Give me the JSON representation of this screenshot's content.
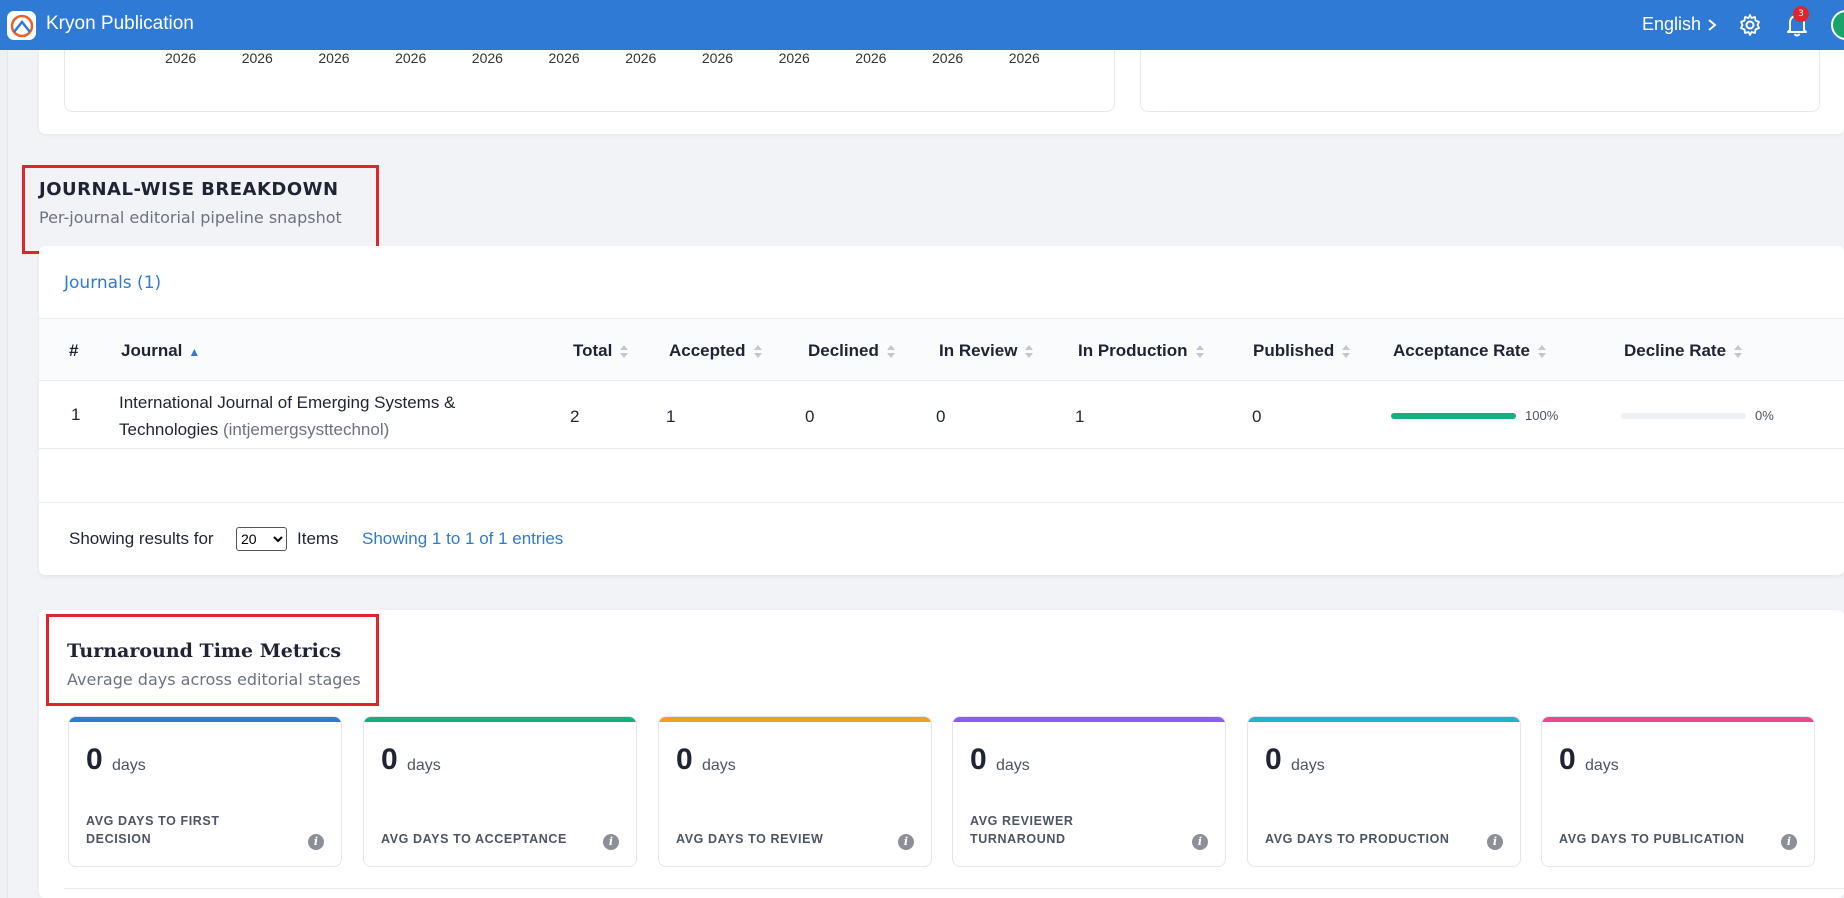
{
  "app": {
    "title": "Kryon Publication"
  },
  "header": {
    "language": "English",
    "notification_count": "3"
  },
  "chart_data": {
    "type": "line",
    "x": [
      "2026",
      "2026",
      "2026",
      "2026",
      "2026",
      "2026",
      "2026",
      "2026",
      "2026",
      "2026",
      "2026",
      "2026"
    ]
  },
  "journal_section": {
    "title": "JOURNAL-WISE BREAKDOWN",
    "subtitle": "Per-journal editorial pipeline snapshot",
    "tab_label": "Journals (1)",
    "columns": [
      "#",
      "Journal",
      "Total",
      "Accepted",
      "Declined",
      "In Review",
      "In Production",
      "Published",
      "Acceptance Rate",
      "Decline Rate"
    ],
    "rows": [
      {
        "index": "1",
        "journal_line1": "International Journal of Emerging Systems &",
        "journal_line2": "Technologies",
        "journal_code": "(intjemergsysttechnol)",
        "total": "2",
        "accepted": "1",
        "declined": "0",
        "in_review": "0",
        "in_production": "1",
        "published": "0",
        "acceptance_rate": "100%",
        "acceptance_rate_value": 1.0,
        "decline_rate": "0%",
        "decline_rate_value": 0.0
      }
    ],
    "footer": {
      "showing_results_for": "Showing results for",
      "page_size": "20",
      "items_label": "Items",
      "entries_text": "Showing 1 to 1 of 1 entries"
    }
  },
  "turnaround_section": {
    "title": "Turnaround Time Metrics",
    "subtitle": "Average days across editorial stages",
    "unit": "days",
    "metrics": [
      {
        "value": "0",
        "label": "AVG DAYS TO FIRST DECISION",
        "color": "#2f7ad4"
      },
      {
        "value": "0",
        "label": "AVG DAYS TO ACCEPTANCE",
        "color": "#16b07a"
      },
      {
        "value": "0",
        "label": "AVG DAYS TO REVIEW",
        "color": "#f0a020"
      },
      {
        "value": "0",
        "label": "AVG REVIEWER TURNAROUND",
        "color": "#8b5cf6"
      },
      {
        "value": "0",
        "label": "AVG DAYS TO PRODUCTION",
        "color": "#1fb5c9"
      },
      {
        "value": "0",
        "label": "AVG DAYS TO PUBLICATION",
        "color": "#e84a8f"
      }
    ]
  },
  "colors": {
    "brand": "#2f7ad4",
    "highlight": "#e0262a",
    "accept_bar": "#16b07a"
  }
}
